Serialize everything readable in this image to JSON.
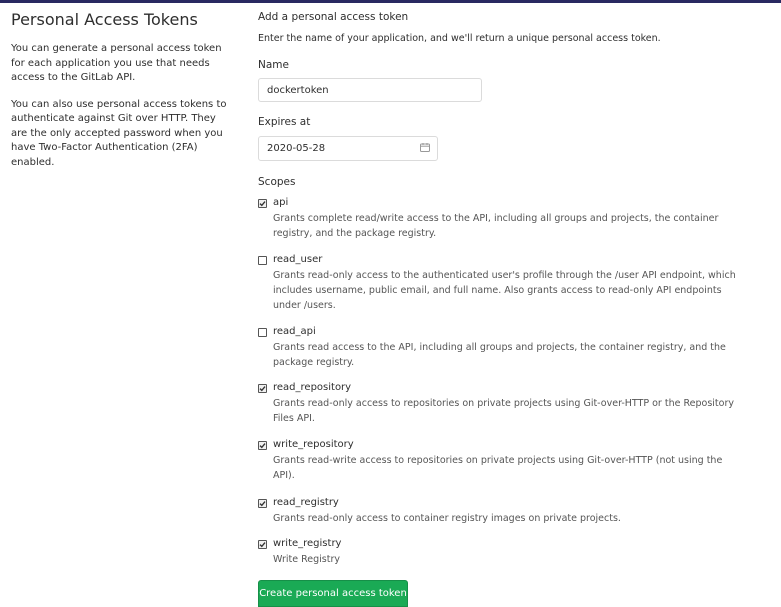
{
  "header": {
    "title": "Personal Access Tokens",
    "intro_1": "You can generate a personal access token for each application you use that needs access to the GitLab API.",
    "intro_2": "You can also use personal access tokens to authenticate against Git over HTTP. They are the only accepted password when you have Two-Factor Authentication (2FA) enabled."
  },
  "form": {
    "section_title": "Add a personal access token",
    "section_desc": "Enter the name of your application, and we'll return a unique personal access token.",
    "name_label": "Name",
    "name_value": "dockertoken",
    "expires_label": "Expires at",
    "expires_value": "2020-05-28",
    "scopes_label": "Scopes",
    "submit_label": "Create personal access token"
  },
  "scopes": [
    {
      "name": "api",
      "checked": true,
      "description": "Grants complete read/write access to the API, including all groups and projects, the container registry, and the package registry."
    },
    {
      "name": "read_user",
      "checked": false,
      "description": "Grants read-only access to the authenticated user's profile through the /user API endpoint, which includes username, public email, and full name. Also grants access to read-only API endpoints under /users."
    },
    {
      "name": "read_api",
      "checked": false,
      "description": "Grants read access to the API, including all groups and projects, the container registry, and the package registry."
    },
    {
      "name": "read_repository",
      "checked": true,
      "description": "Grants read-only access to repositories on private projects using Git-over-HTTP or the Repository Files API."
    },
    {
      "name": "write_repository",
      "checked": true,
      "description": "Grants read-write access to repositories on private projects using Git-over-HTTP (not using the API)."
    },
    {
      "name": "read_registry",
      "checked": true,
      "description": "Grants read-only access to container registry images on private projects."
    },
    {
      "name": "write_registry",
      "checked": true,
      "description": "Write Registry"
    }
  ],
  "colors": {
    "top_bar": "#292961",
    "primary_button": "#1aaa55"
  }
}
